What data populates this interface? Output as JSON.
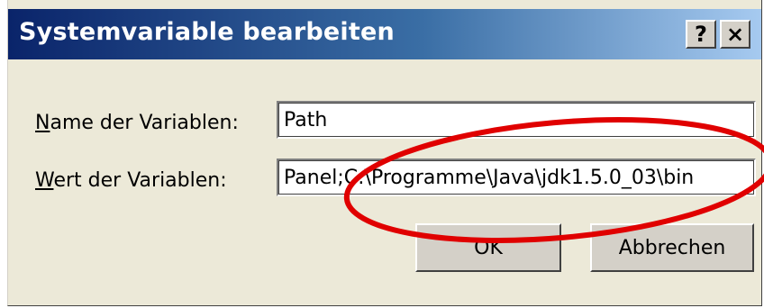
{
  "window": {
    "title": "Systemvariable bearbeiten",
    "help_button": "?",
    "close_button": "×"
  },
  "form": {
    "name_label_access": "N",
    "name_label_rest": "ame der Variablen:",
    "name_value": "Path",
    "value_label_access": "W",
    "value_label_rest": "ert der Variablen:",
    "value_value": "Panel;C:\\Programme\\Java\\jdk1.5.0_03\\bin"
  },
  "buttons": {
    "ok": "OK",
    "cancel": "Abbrechen"
  },
  "colors": {
    "annotation": "#e00000",
    "titlebar_start": "#0a246a",
    "titlebar_end": "#a6caf0",
    "dialog_face": "#ece9d8"
  }
}
